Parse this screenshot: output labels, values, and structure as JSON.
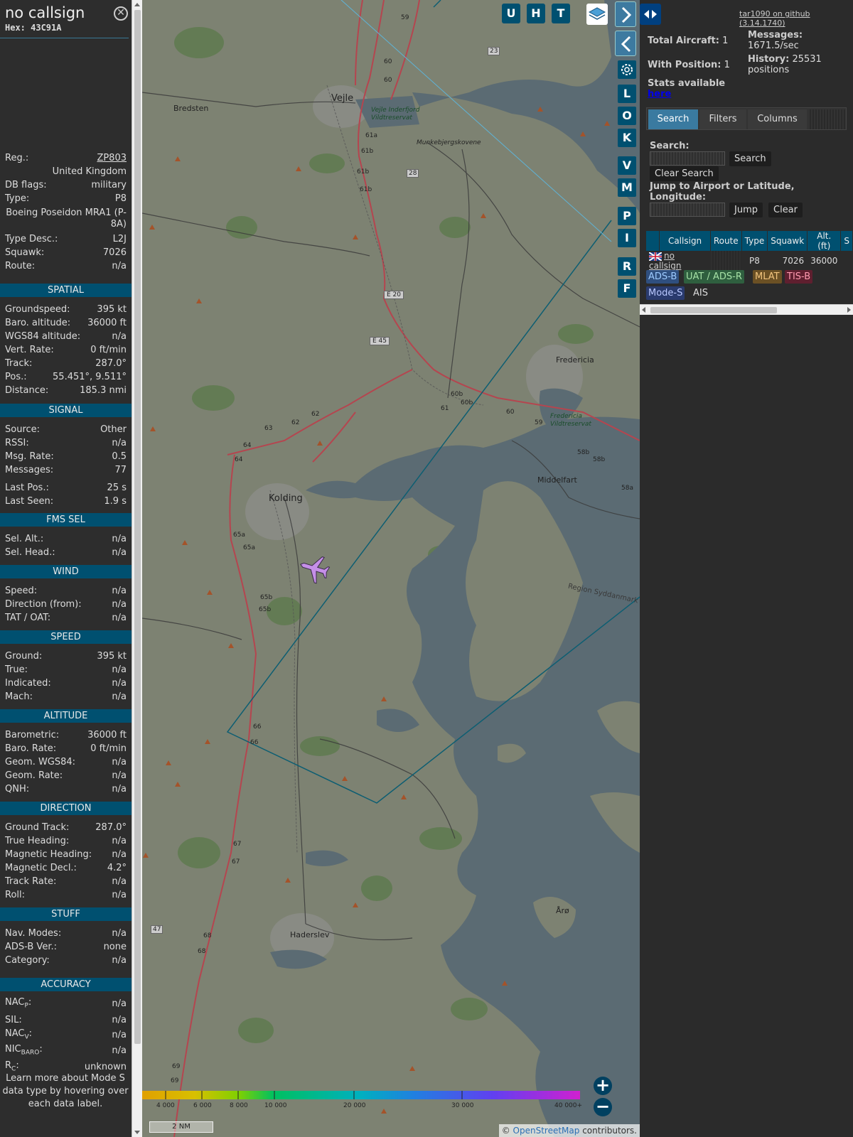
{
  "aircraft": {
    "callsign": "no callsign",
    "hex": "Hex: 43C91A",
    "reg_label": "Reg.:",
    "reg": "ZP803",
    "country": "United Kingdom",
    "dbflags_label": "DB flags:",
    "dbflags": "military",
    "type_label": "Type:",
    "type": "P8",
    "type_name": "Boeing Poseidon MRA1 (P-8A)",
    "typedesc_label": "Type Desc.:",
    "typedesc": "L2J",
    "squawk_label": "Squawk:",
    "squawk": "7026",
    "route_label": "Route:",
    "route": "n/a"
  },
  "sections": {
    "spatial": {
      "title": "SPATIAL",
      "rows": [
        {
          "label": "Groundspeed:",
          "value": "395 kt"
        },
        {
          "label": "Baro. altitude:",
          "value": "36000 ft"
        },
        {
          "label": "WGS84 altitude:",
          "value": "n/a"
        },
        {
          "label": "Vert. Rate:",
          "value": "0 ft/min"
        },
        {
          "label": "Track:",
          "value": "287.0°"
        },
        {
          "label": "Pos.:",
          "value": "55.451°, 9.511°"
        },
        {
          "label": "Distance:",
          "value": "185.3 nmi"
        }
      ]
    },
    "signal": {
      "title": "SIGNAL",
      "rows": [
        {
          "label": "Source:",
          "value": "Other"
        },
        {
          "label": "RSSI:",
          "value": "n/a"
        },
        {
          "label": "Msg. Rate:",
          "value": "0.5"
        },
        {
          "label": "Messages:",
          "value": "77"
        },
        {
          "label": "Last Pos.:",
          "value": "25 s"
        },
        {
          "label": "Last Seen:",
          "value": "1.9 s"
        }
      ]
    },
    "fmssel": {
      "title": "FMS SEL",
      "rows": [
        {
          "label": "Sel. Alt.:",
          "value": "n/a"
        },
        {
          "label": "Sel. Head.:",
          "value": "n/a"
        }
      ]
    },
    "wind": {
      "title": "WIND",
      "rows": [
        {
          "label": "Speed:",
          "value": "n/a"
        },
        {
          "label": "Direction (from):",
          "value": "n/a"
        },
        {
          "label": "TAT / OAT:",
          "value": "n/a"
        }
      ]
    },
    "speed": {
      "title": "SPEED",
      "rows": [
        {
          "label": "Ground:",
          "value": "395 kt"
        },
        {
          "label": "True:",
          "value": "n/a"
        },
        {
          "label": "Indicated:",
          "value": "n/a"
        },
        {
          "label": "Mach:",
          "value": "n/a"
        }
      ]
    },
    "altitude": {
      "title": "ALTITUDE",
      "rows": [
        {
          "label": "Barometric:",
          "value": "36000 ft"
        },
        {
          "label": "Baro. Rate:",
          "value": "0 ft/min"
        },
        {
          "label": "Geom. WGS84:",
          "value": "n/a"
        },
        {
          "label": "Geom. Rate:",
          "value": "n/a"
        },
        {
          "label": "QNH:",
          "value": "n/a"
        }
      ]
    },
    "direction": {
      "title": "DIRECTION",
      "rows": [
        {
          "label": "Ground Track:",
          "value": "287.0°"
        },
        {
          "label": "True Heading:",
          "value": "n/a"
        },
        {
          "label": "Magnetic Heading:",
          "value": "n/a"
        },
        {
          "label": "Magnetic Decl.:",
          "value": "4.2°"
        },
        {
          "label": "Track Rate:",
          "value": "n/a"
        },
        {
          "label": "Roll:",
          "value": "n/a"
        }
      ]
    },
    "stuff": {
      "title": "STUFF",
      "rows": [
        {
          "label": "Nav. Modes:",
          "value": "n/a"
        },
        {
          "label": "ADS-B Ver.:",
          "value": "none"
        },
        {
          "label": "Category:",
          "value": "n/a"
        }
      ]
    },
    "accuracy": {
      "title": "ACCURACY",
      "nacp_main": "NAC",
      "nacp_sub": "P",
      "nacp_value": "n/a",
      "sil_label": "SIL:",
      "sil_value": "n/a",
      "nacv_main": "NAC",
      "nacv_sub": "V",
      "nacv_value": "n/a",
      "nicbaro_main": "NIC",
      "nicbaro_sub": "BARO",
      "nicbaro_value": "n/a",
      "rc_main": "R",
      "rc_sub": "C",
      "rc_value": "unknown"
    }
  },
  "footnote": "Learn more about Mode S data type by hovering over each data label.",
  "map": {
    "top_buttons": [
      "U",
      "H",
      "T"
    ],
    "side_buttons": [
      "L",
      "O",
      "K",
      "V",
      "M",
      "P",
      "I",
      "R",
      "F"
    ],
    "places": {
      "vejle": "Vejle",
      "bredsten": "Bredsten",
      "kolding": "Kolding",
      "fredericia": "Fredericia",
      "middelfart": "Middelfart",
      "haderslev": "Haderslev",
      "aro": "Årø",
      "vejle_fjord": "Vejle Inderfjord Vildtreservat",
      "munkebjerg": "Munkebjergskovene",
      "fredericia_res": "Fredericia Vildtreservat",
      "region": "Region Syddanmark"
    },
    "roads": {
      "r59": "59",
      "r60": "60",
      "r60b": "60",
      "r23": "23",
      "r61a": "61a",
      "r61b": "61b",
      "r61c": "61b",
      "r28": "28",
      "r61d": "61b",
      "re20": "E 20",
      "re45": "E 45",
      "r60c": "60b",
      "r60d": "60b",
      "r61e": "61",
      "r60e": "60",
      "r59b": "59",
      "r58b": "58b",
      "r58c": "58b",
      "r58d": "58a",
      "r62": "62",
      "r62b": "62",
      "r63": "63",
      "r64": "64",
      "r64b": "64",
      "r65a": "65a",
      "r65b": "65a",
      "r65c": "65b",
      "r65d": "65b",
      "r66": "66",
      "r66b": "66",
      "r67": "67",
      "r67b": "67",
      "r47": "47",
      "r68": "68",
      "r68b": "68",
      "r69": "69",
      "r69b": "69"
    },
    "altitude_scale": [
      "4 000",
      "6 000",
      "8 000",
      "10 000",
      "20 000",
      "30 000",
      "40 000+"
    ],
    "scale_label": "2 NM",
    "attribution_prefix": "© ",
    "attribution_link": "OpenStreetMap",
    "attribution_suffix": " contributors.",
    "zoom_in": "+",
    "zoom_out": "−"
  },
  "right": {
    "github_link": "tar1090 on github (3.14.1740)",
    "total_aircraft_label": "Total Aircraft:",
    "total_aircraft": "1",
    "with_position_label": "With Position:",
    "with_position": "1",
    "stats_text": "Stats available",
    "stats_link": "here",
    "messages_label": "Messages:",
    "messages_value": "1671.5/sec",
    "history_label": "History:",
    "history_value": "25531 positions",
    "tabs": [
      "Search",
      "Filters",
      "Columns"
    ],
    "search_label": "Search:",
    "search_button": "Search",
    "clear_search_button": "Clear Search",
    "jump_label": "Jump to Airport or Latitude, Longitude:",
    "jump_button": "Jump",
    "clear_button": "Clear",
    "table_headers": [
      "",
      "Callsign",
      "Route",
      "Type",
      "Squawk",
      "Alt. (ft)",
      "S"
    ],
    "table_rows": [
      {
        "callsign": "no callsign",
        "route": "",
        "type": "P8",
        "squawk": "7026",
        "alt": "36000"
      }
    ],
    "sources": [
      {
        "label": "ADS-B",
        "color": "#2f4f7f",
        "text": "#9ecbff"
      },
      {
        "label": "UAT / ADS-R",
        "color": "#2f5f3f",
        "text": "#a6e0a6"
      },
      {
        "label": "MLAT",
        "color": "#6b5024",
        "text": "#f2c47e"
      },
      {
        "label": "TIS-B",
        "color": "#5f1f2f",
        "text": "#ff9ab0"
      },
      {
        "label": "Mode-S",
        "color": "#2a3b6e",
        "text": "#b9c8ff"
      },
      {
        "label": "AIS",
        "color": "#2b2b2b",
        "text": "#dddddd"
      }
    ]
  }
}
